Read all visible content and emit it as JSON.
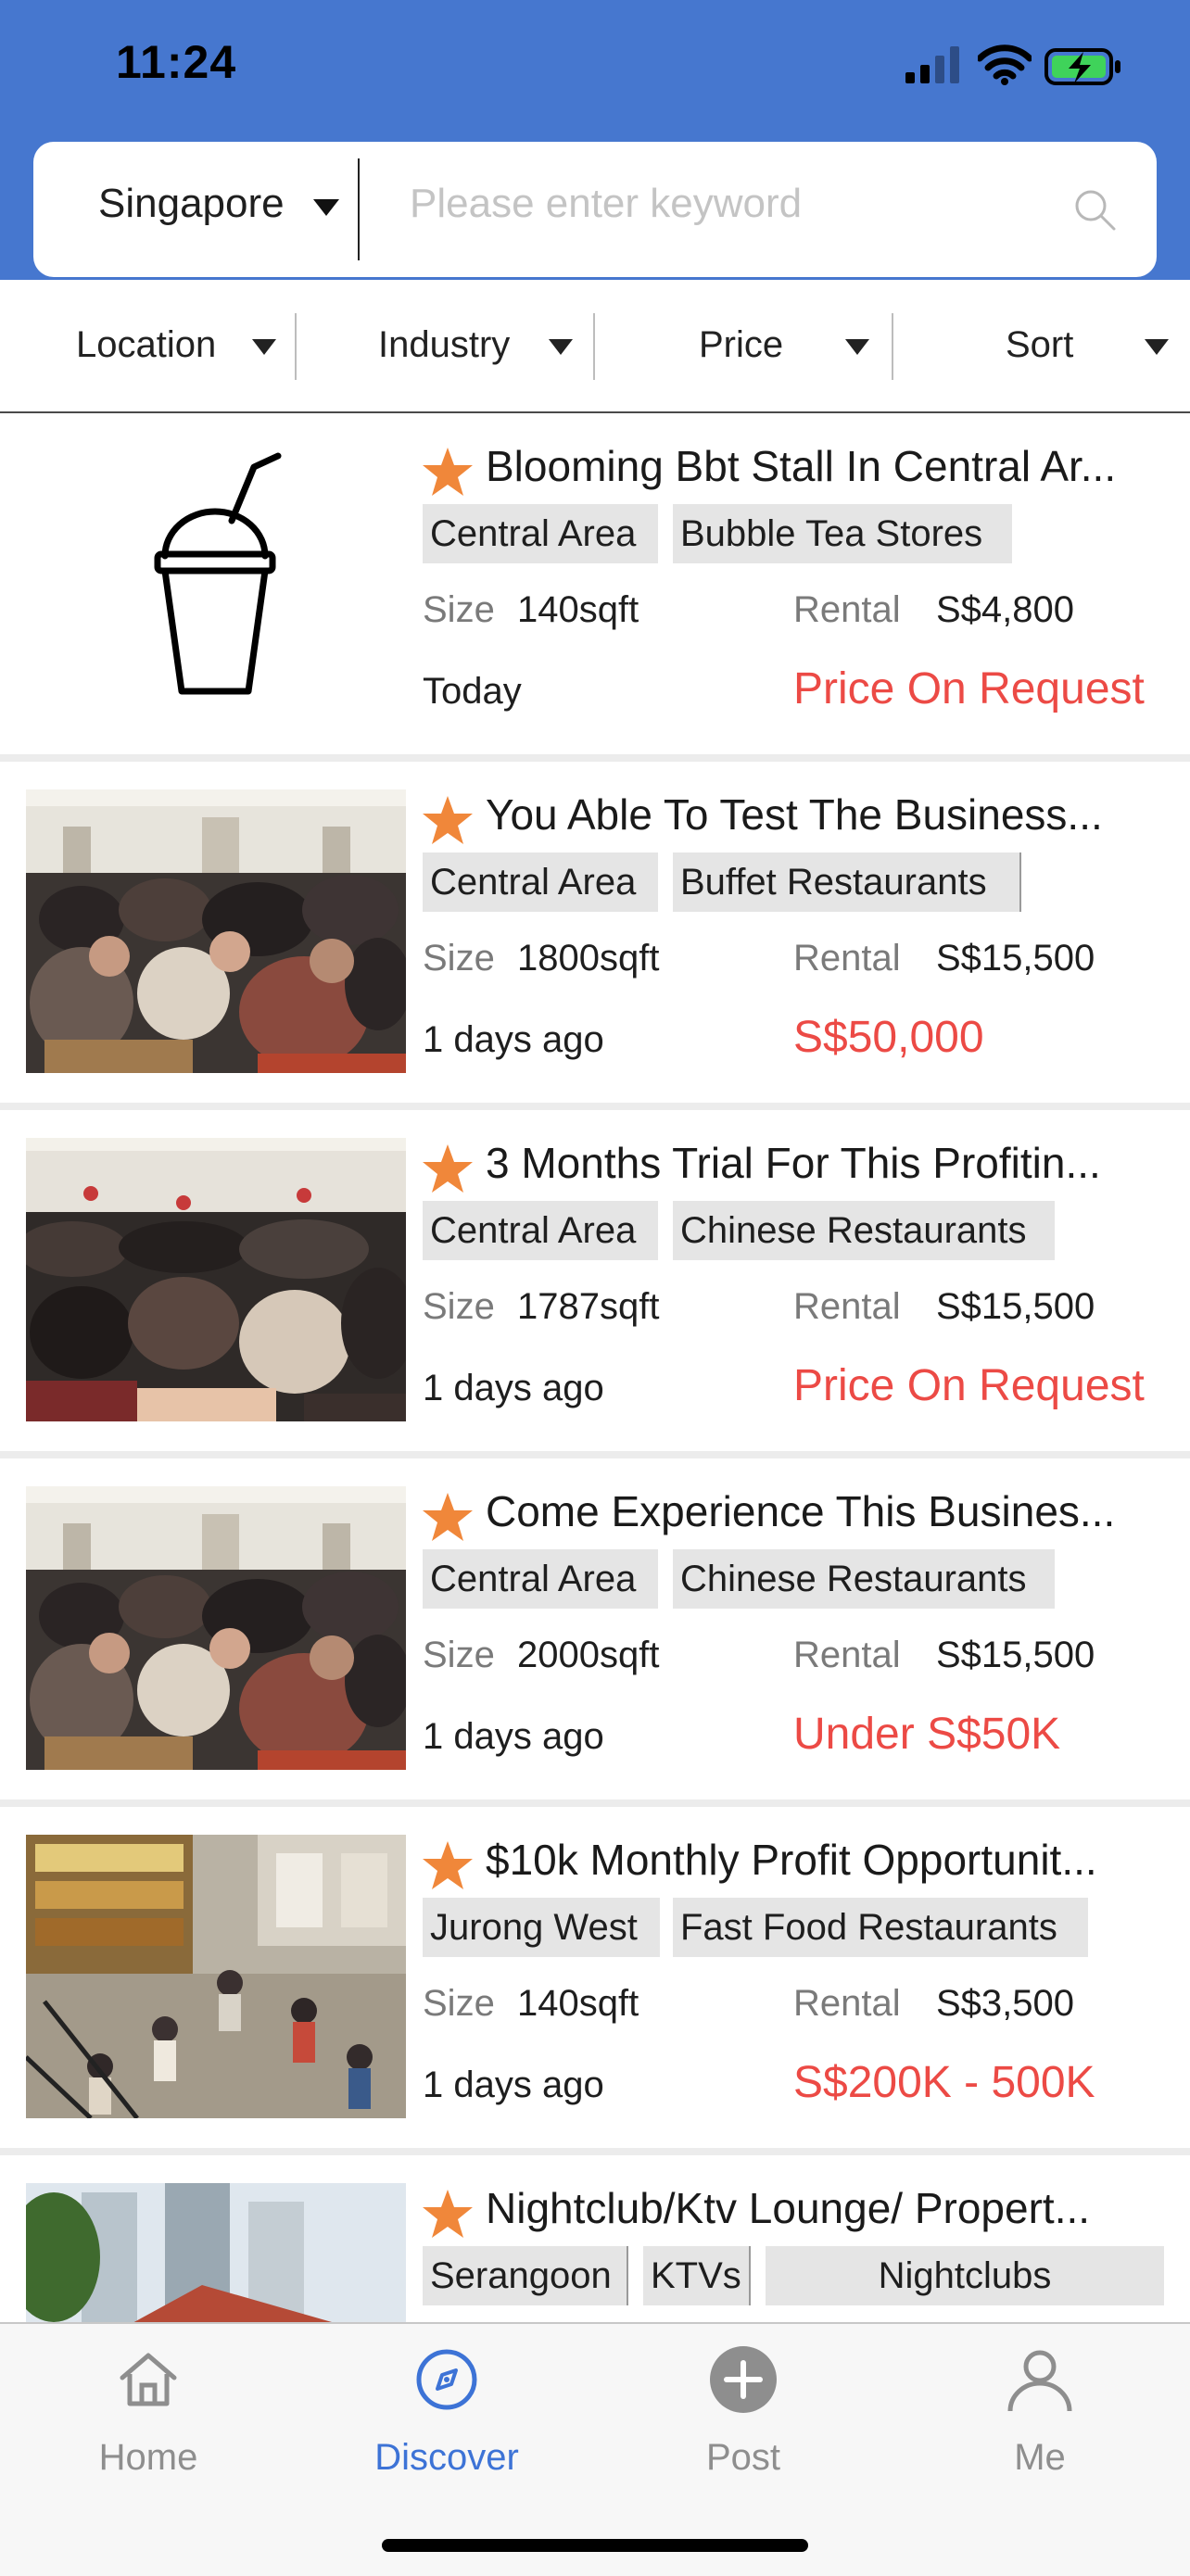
{
  "status_bar": {
    "time": "11:24"
  },
  "search": {
    "city": "Singapore",
    "placeholder": "Please enter keyword"
  },
  "filters": [
    {
      "label": "Location"
    },
    {
      "label": "Industry"
    },
    {
      "label": "Price"
    },
    {
      "label": "Sort"
    }
  ],
  "listings": [
    {
      "title": "Blooming Bbt Stall In Central Ar...",
      "tags": [
        "Central Area",
        "Bubble Tea Stores"
      ],
      "size_label": "Size",
      "size": "140sqft",
      "rental_label": "Rental",
      "rental": "S$4,800",
      "date": "Today",
      "price": "Price On Request",
      "thumb": "bubble-tea-cup-icon"
    },
    {
      "title": "You Able To Test The Business...",
      "tags": [
        "Central Area",
        "Buffet Restaurants"
      ],
      "size_label": "Size",
      "size": "1800sqft",
      "rental_label": "Rental",
      "rental": "S$15,500",
      "date": "1 days ago",
      "price": "S$50,000",
      "thumb": "restaurant-photo"
    },
    {
      "title": "3 Months Trial For This Profitin...",
      "tags": [
        "Central Area",
        "Chinese Restaurants"
      ],
      "size_label": "Size",
      "size": "1787sqft",
      "rental_label": "Rental",
      "rental": "S$15,500",
      "date": "1 days ago",
      "price": "Price On Request",
      "thumb": "restaurant-photo"
    },
    {
      "title": "Come Experience This Busines...",
      "tags": [
        "Central Area",
        "Chinese Restaurants"
      ],
      "size_label": "Size",
      "size": "2000sqft",
      "rental_label": "Rental",
      "rental": "S$15,500",
      "date": "1 days ago",
      "price": "Under S$50K",
      "thumb": "restaurant-photo"
    },
    {
      "title": "$10k Monthly Profit Opportunit...",
      "tags": [
        "Jurong West",
        "Fast Food Restaurants"
      ],
      "size_label": "Size",
      "size": "140sqft",
      "rental_label": "Rental",
      "rental": "S$3,500",
      "date": "1 days ago",
      "price": "S$200K - 500K",
      "thumb": "food-court-photo"
    },
    {
      "title": "Nightclub/Ktv Lounge/ Propert...",
      "tags": [
        "Serangoon",
        "KTVs",
        "Nightclubs"
      ],
      "thumb": "building-photo"
    }
  ],
  "tabbar": [
    {
      "label": "Home",
      "icon": "home-icon"
    },
    {
      "label": "Discover",
      "icon": "compass-icon",
      "active": true
    },
    {
      "label": "Post",
      "icon": "plus-circle-icon"
    },
    {
      "label": "Me",
      "icon": "person-icon"
    }
  ],
  "colors": {
    "header": "#4677cf",
    "accent": "#3d73d6",
    "price": "#ec4a45",
    "star": "#f0873a",
    "tag_bg": "#e5e5e5"
  }
}
